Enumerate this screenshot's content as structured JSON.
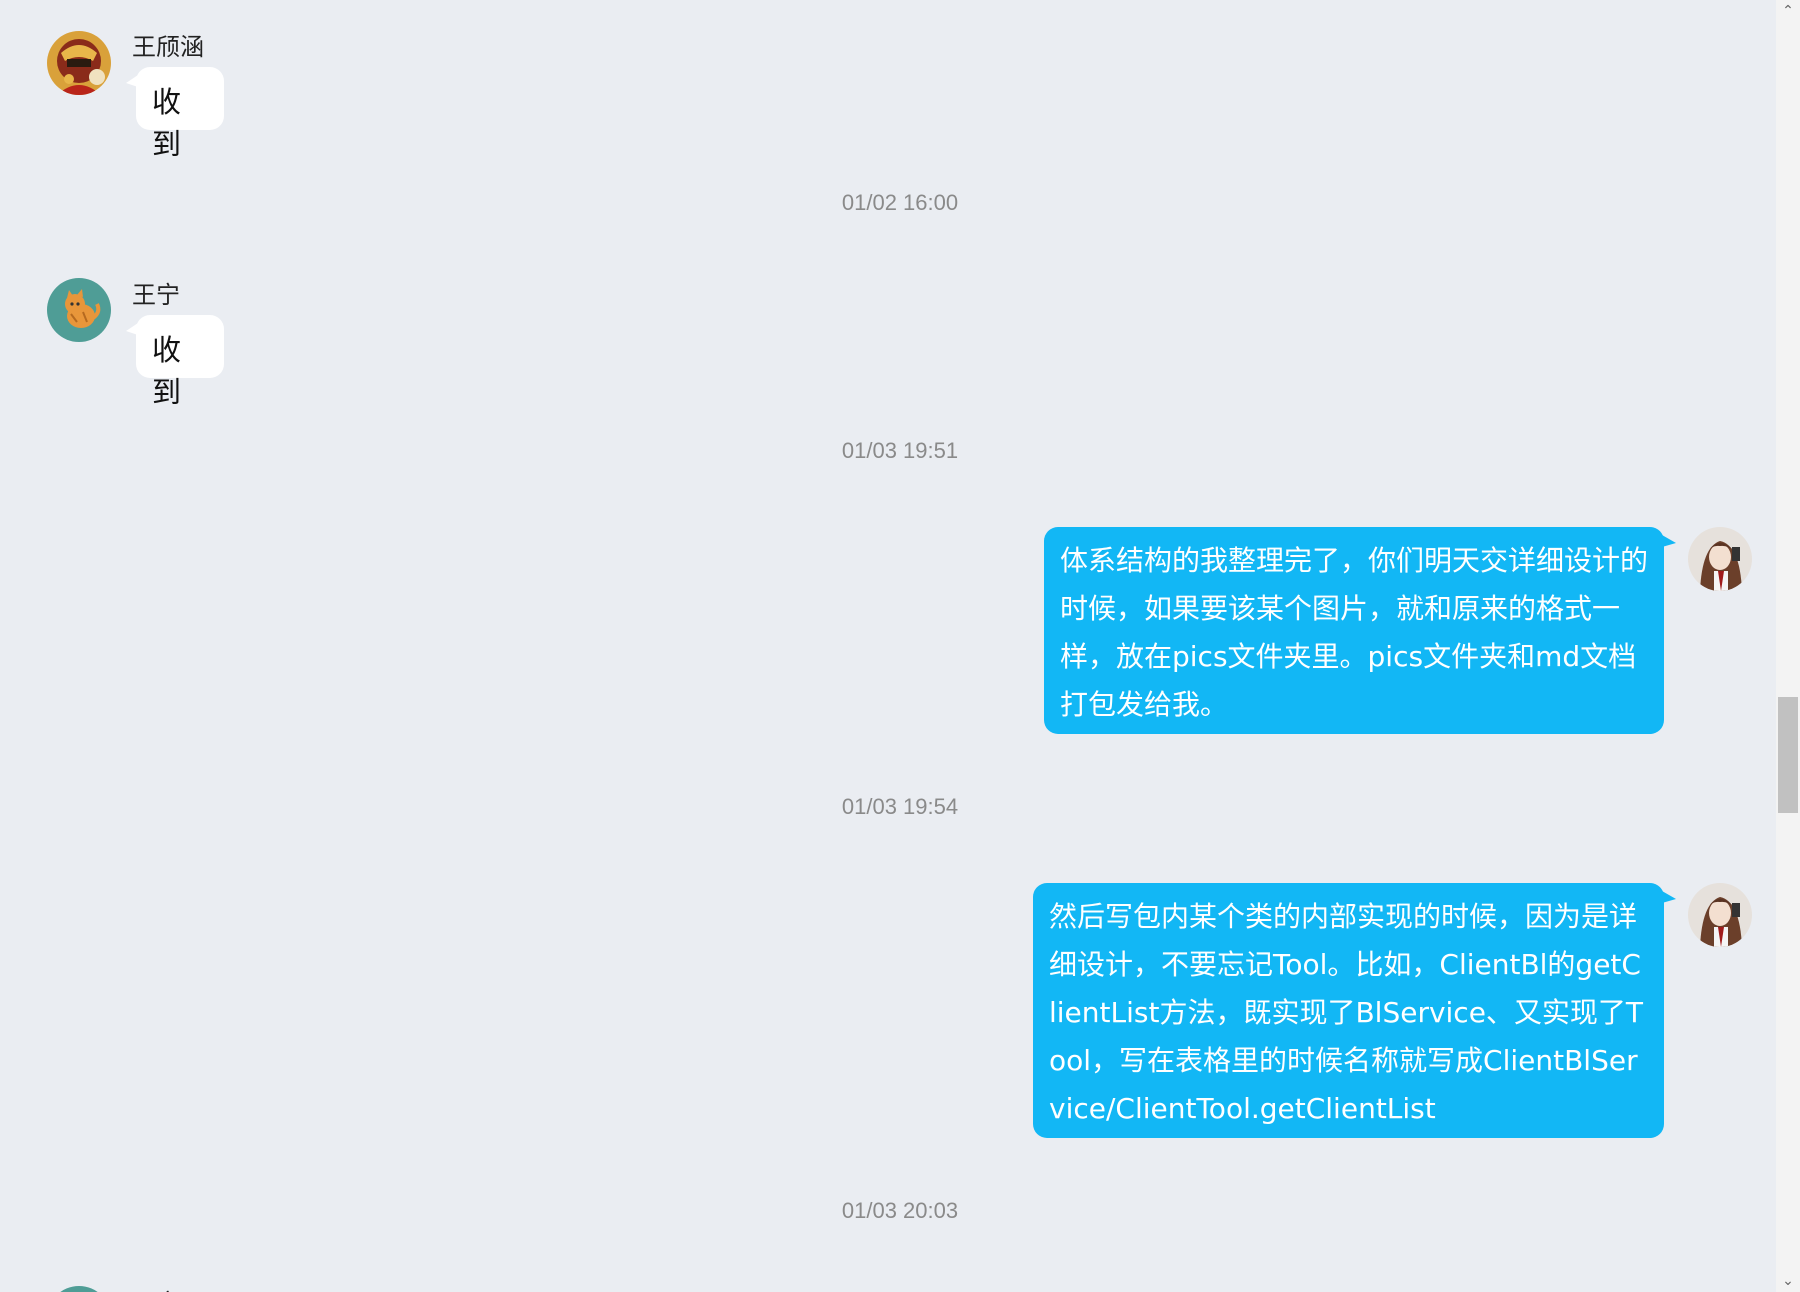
{
  "messages": [
    {
      "type": "incoming",
      "sender": "王颀涵",
      "text": "收到"
    },
    {
      "type": "timestamp",
      "text": "01/02 16:00"
    },
    {
      "type": "incoming",
      "sender": "王宁",
      "text": "收到"
    },
    {
      "type": "timestamp",
      "text": "01/03 19:51"
    },
    {
      "type": "outgoing",
      "text": "体系结构的我整理完了，你们明天交详细设计的时候，如果要该某个图片，就和原来的格式一样，放在pics文件夹里。pics文件夹和md文档打包发给我。"
    },
    {
      "type": "timestamp",
      "text": "01/03 19:54"
    },
    {
      "type": "outgoing",
      "text": "然后写包内某个类的内部实现的时候，因为是详细设计，不要忘记Tool。比如，ClientBl的getClientList方法，既实现了BlService、又实现了Tool，写在表格里的时候名称就写成ClientBlService/ClientTool.getClientList"
    },
    {
      "type": "timestamp",
      "text": "01/03 20:03"
    },
    {
      "type": "incoming",
      "sender": "王宁",
      "text": ""
    }
  ],
  "colors": {
    "background": "#eaedf2",
    "outgoing_bubble": "#12b7f5",
    "incoming_bubble": "#ffffff",
    "timestamp_text": "#8a8a8a"
  },
  "icons": {
    "avatar_1": "ironman-avatar-icon",
    "avatar_2": "cat-avatar-icon",
    "self_avatar": "self-avatar-icon"
  }
}
